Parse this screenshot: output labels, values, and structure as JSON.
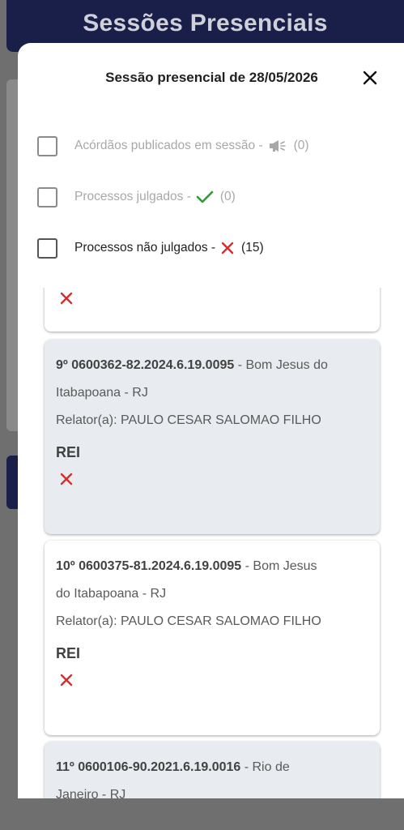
{
  "background": {
    "title": "Sessões Presenciais"
  },
  "modal": {
    "title": "Sessão presencial de 28/05/2026",
    "close_icon": "close-icon"
  },
  "filters": [
    {
      "label": "Acórdãos publicados em sessão -",
      "icon": "megaphone-icon",
      "count": "(0)",
      "checked": false,
      "enabled": false
    },
    {
      "label": "Processos julgados -",
      "icon": "check-icon",
      "count": "(0)",
      "checked": false,
      "enabled": false
    },
    {
      "label": "Processos não julgados -",
      "icon": "x-icon",
      "count": "(15)",
      "checked": false,
      "enabled": true
    }
  ],
  "cards": [
    {
      "number": "9º 0600362-82.2024.6.19.0095",
      "location_a": " - Bom Jesus do",
      "location_b": "Itabapoana - RJ",
      "relator": "Relator(a): PAULO CESAR SALOMAO FILHO",
      "type": "REI",
      "status": "not-judged"
    },
    {
      "number": "10º 0600375-81.2024.6.19.0095",
      "location_a": " - Bom Jesus",
      "location_b": "do Itabapoana - RJ",
      "relator": "Relator(a): PAULO CESAR SALOMAO FILHO",
      "type": "REI",
      "status": "not-judged"
    },
    {
      "number": "11º 0600106-90.2021.6.19.0016",
      "location_a": " - Rio de",
      "location_b": "Janeiro - RJ",
      "status": "not-judged"
    }
  ],
  "colors": {
    "header_bg": "#1a1f4a",
    "check_green": "#2e9b3a",
    "x_red": "#d32f2f",
    "card_gray": "#e8ebef"
  }
}
